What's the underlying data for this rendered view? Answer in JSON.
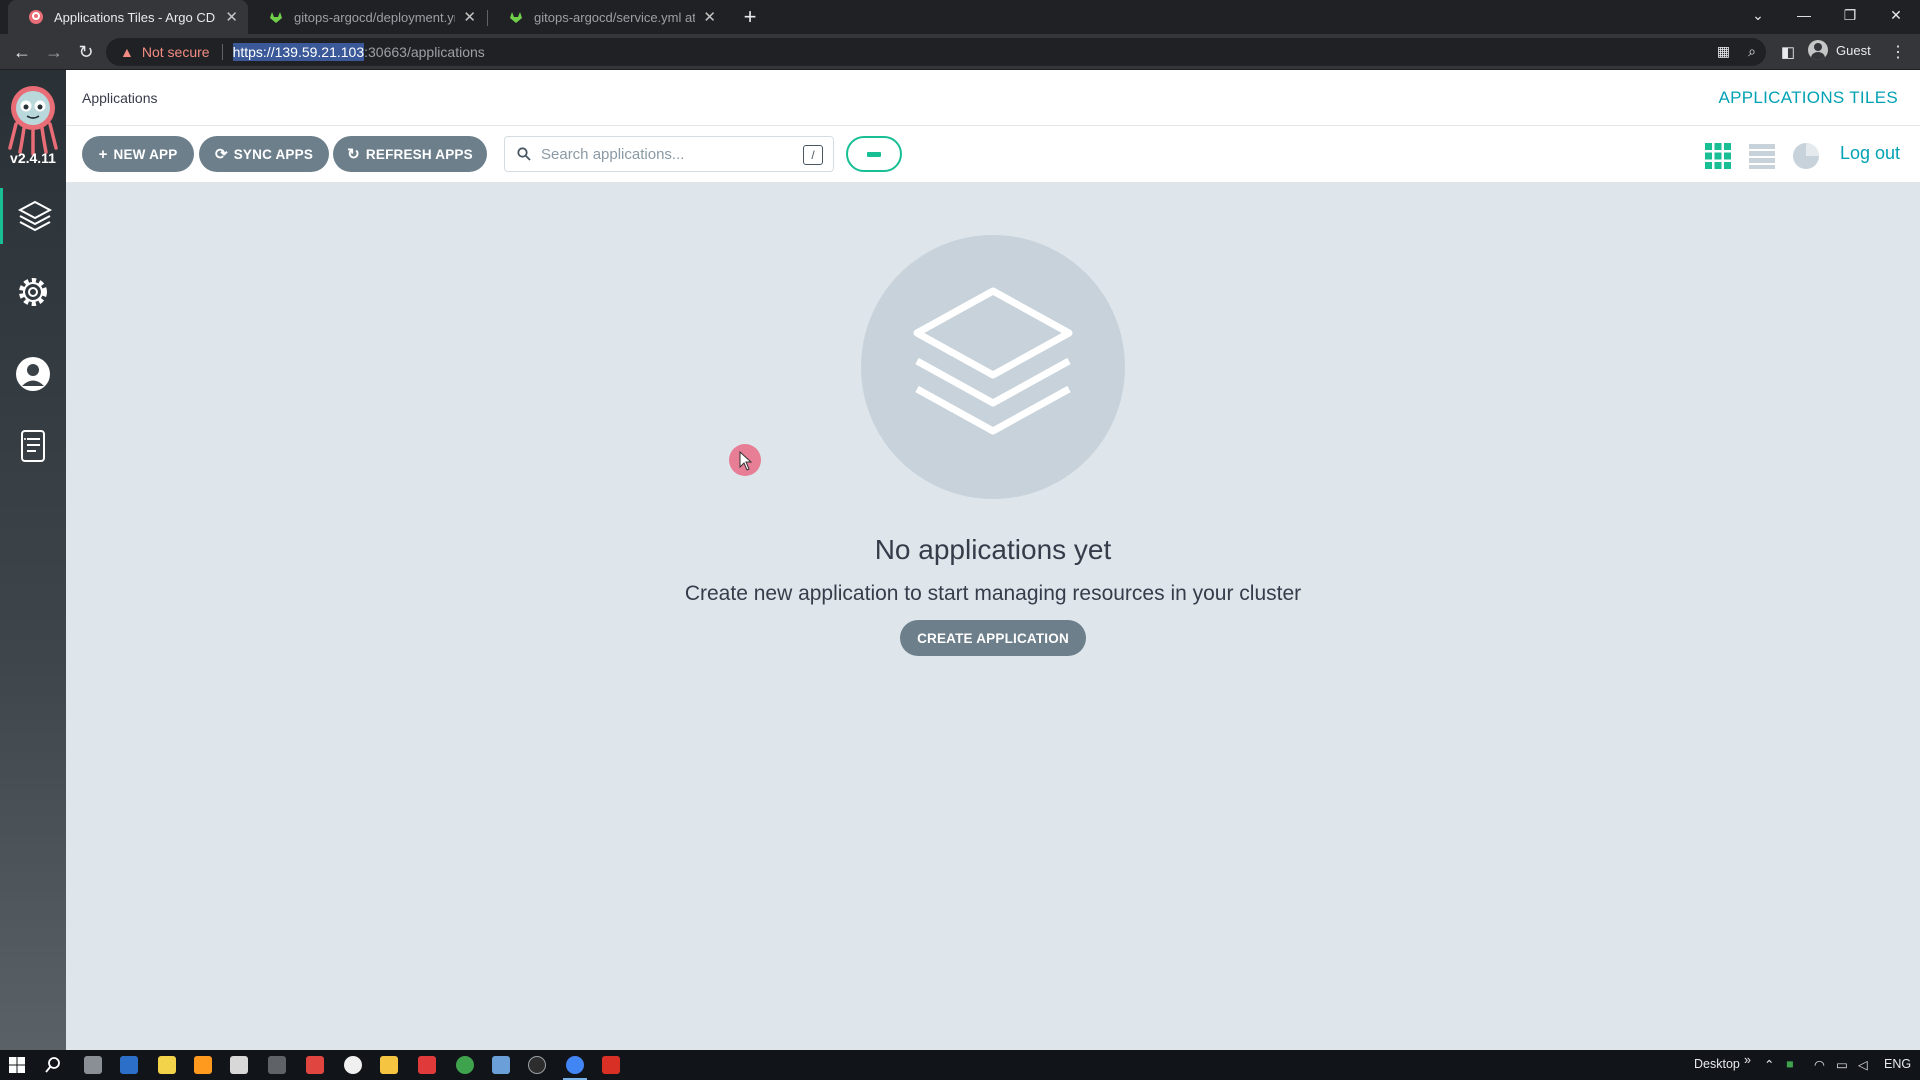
{
  "browser": {
    "tabs": [
      {
        "title": "Applications Tiles - Argo CD",
        "active": true
      },
      {
        "title": "gitops-argocd/deployment.yml a",
        "active": false
      },
      {
        "title": "gitops-argocd/service.yml at mai",
        "active": false
      }
    ],
    "security_label": "Not secure",
    "url_host": "https://139.59.21.103",
    "url_rest": ":30663/applications",
    "profile_label": "Guest"
  },
  "sidebar": {
    "version": "v2.4.11",
    "items": [
      {
        "name": "applications",
        "icon": "layers-icon",
        "active": true
      },
      {
        "name": "settings",
        "icon": "gear-icon",
        "active": false
      },
      {
        "name": "user-info",
        "icon": "user-icon",
        "active": false
      },
      {
        "name": "documentation",
        "icon": "docs-icon",
        "active": false
      }
    ]
  },
  "header": {
    "breadcrumb": "Applications",
    "title": "APPLICATIONS TILES"
  },
  "toolbar": {
    "new_app": "NEW APP",
    "sync_apps": "SYNC APPS",
    "refresh_apps": "REFRESH APPS",
    "search_placeholder": "Search applications...",
    "search_shortcut": "/",
    "logout": "Log out"
  },
  "empty_state": {
    "title": "No applications yet",
    "subtitle": "Create new application to start managing resources in your cluster",
    "button": "CREATE APPLICATION"
  },
  "taskbar": {
    "desktop_label": "Desktop",
    "language": "ENG"
  },
  "colors": {
    "accent": "#00a2b3",
    "green": "#18be94",
    "button_gray": "#6d7f8b",
    "background": "#dee6eb"
  }
}
